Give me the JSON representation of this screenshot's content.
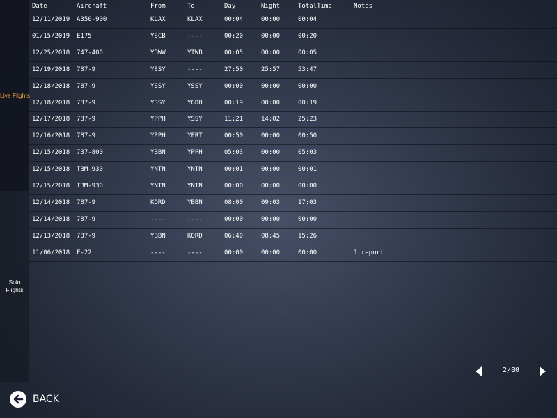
{
  "sidebar": {
    "live_label": "Live Flights",
    "solo_label": "Solo\nFlights",
    "active": "Live Flights",
    "active_color": "#e8a341"
  },
  "table": {
    "columns": {
      "date": "Date",
      "aircraft": "Aircraft",
      "from": "From",
      "to": "To",
      "day": "Day",
      "night": "Night",
      "total": "TotalTime",
      "notes": "Notes"
    },
    "rows": [
      {
        "date": "12/11/2019",
        "aircraft": "A350-900",
        "from": "KLAX",
        "to": "KLAX",
        "day": "00:04",
        "night": "00:00",
        "total": "00:04",
        "notes": ""
      },
      {
        "date": "01/15/2019",
        "aircraft": "E175",
        "from": "YSCB",
        "to": "----",
        "day": "00:20",
        "night": "00:00",
        "total": "00:20",
        "notes": ""
      },
      {
        "date": "12/25/2018",
        "aircraft": "747-400",
        "from": "YBWW",
        "to": "YTWB",
        "day": "00:05",
        "night": "00:00",
        "total": "00:05",
        "notes": ""
      },
      {
        "date": "12/19/2018",
        "aircraft": "787-9",
        "from": "YSSY",
        "to": "----",
        "day": "27:50",
        "night": "25:57",
        "total": "53:47",
        "notes": ""
      },
      {
        "date": "12/18/2018",
        "aircraft": "787-9",
        "from": "YSSY",
        "to": "YSSY",
        "day": "00:00",
        "night": "00:00",
        "total": "00:00",
        "notes": ""
      },
      {
        "date": "12/18/2018",
        "aircraft": "787-9",
        "from": "YSSY",
        "to": "YGDO",
        "day": "00:19",
        "night": "00:00",
        "total": "00:19",
        "notes": ""
      },
      {
        "date": "12/17/2018",
        "aircraft": "787-9",
        "from": "YPPH",
        "to": "YSSY",
        "day": "11:21",
        "night": "14:02",
        "total": "25:23",
        "notes": ""
      },
      {
        "date": "12/16/2018",
        "aircraft": "787-9",
        "from": "YPPH",
        "to": "YFRT",
        "day": "00:50",
        "night": "00:00",
        "total": "00:50",
        "notes": ""
      },
      {
        "date": "12/15/2018",
        "aircraft": "737-800",
        "from": "YBBN",
        "to": "YPPH",
        "day": "05:03",
        "night": "00:00",
        "total": "05:03",
        "notes": ""
      },
      {
        "date": "12/15/2018",
        "aircraft": "TBM-930",
        "from": "YNTN",
        "to": "YNTN",
        "day": "00:01",
        "night": "00:00",
        "total": "00:01",
        "notes": ""
      },
      {
        "date": "12/15/2018",
        "aircraft": "TBM-930",
        "from": "YNTN",
        "to": "YNTN",
        "day": "00:00",
        "night": "00:00",
        "total": "00:00",
        "notes": ""
      },
      {
        "date": "12/14/2018",
        "aircraft": "787-9",
        "from": "KORD",
        "to": "YBBN",
        "day": "08:00",
        "night": "09:03",
        "total": "17:03",
        "notes": ""
      },
      {
        "date": "12/14/2018",
        "aircraft": "787-9",
        "from": "----",
        "to": "----",
        "day": "00:00",
        "night": "00:00",
        "total": "00:00",
        "notes": ""
      },
      {
        "date": "12/13/2018",
        "aircraft": "787-9",
        "from": "YBBN",
        "to": "KORD",
        "day": "06:40",
        "night": "08:45",
        "total": "15:26",
        "notes": ""
      },
      {
        "date": "11/06/2018",
        "aircraft": "F-22",
        "from": "----",
        "to": "----",
        "day": "00:00",
        "night": "00:00",
        "total": "00:00",
        "notes": "1 report"
      }
    ]
  },
  "pagination": {
    "page_text": "2/80",
    "prev_icon": "chevron-left-icon",
    "next_icon": "chevron-right-icon"
  },
  "footer": {
    "back_label": "BACK",
    "back_icon": "arrow-left-circle-icon"
  }
}
